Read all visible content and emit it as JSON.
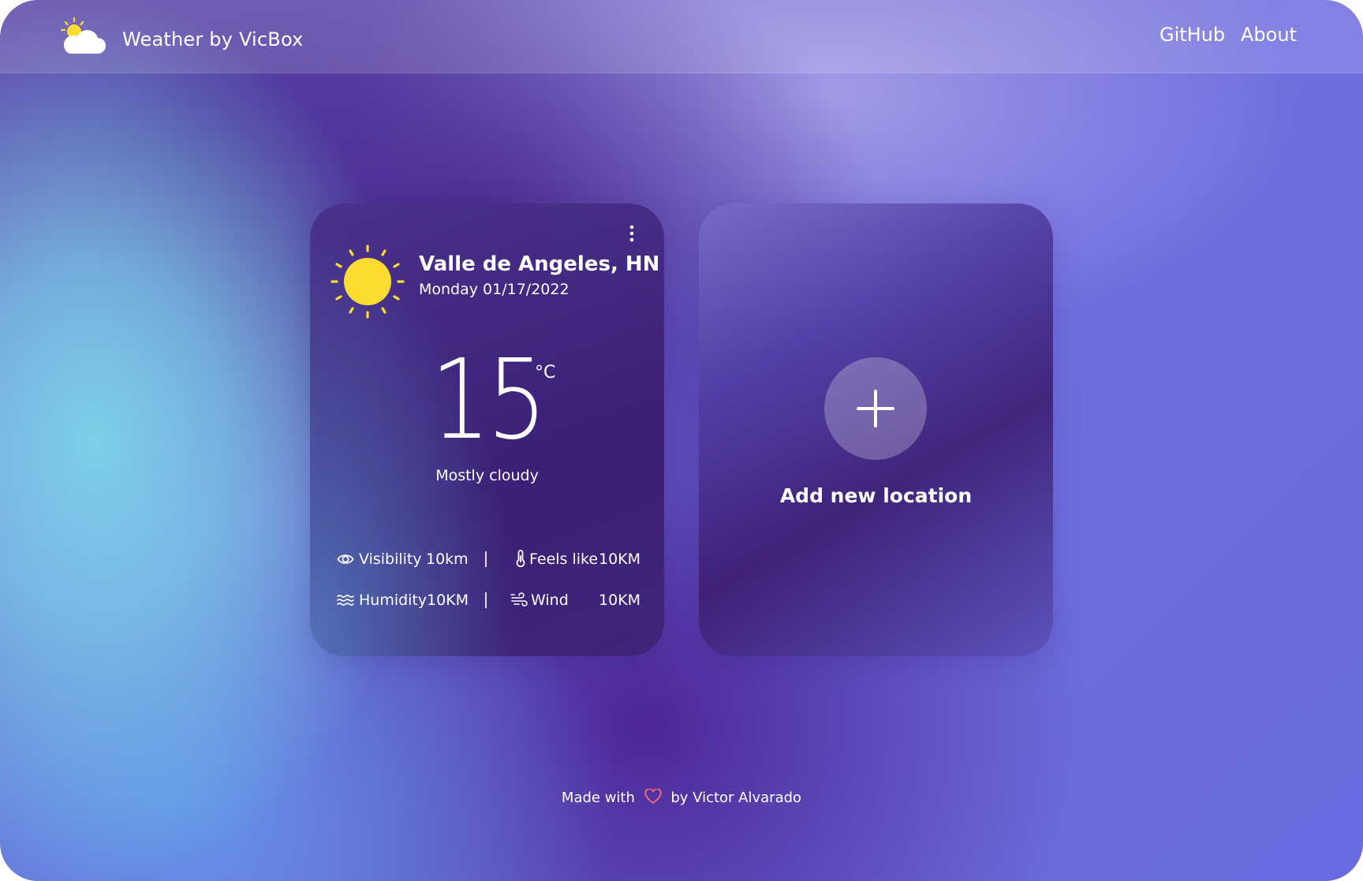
{
  "header": {
    "brand": "Weather by VicBox",
    "logo_icon": "sun-cloud-icon",
    "nav": [
      {
        "label": "GitHub"
      },
      {
        "label": "About"
      }
    ]
  },
  "weather_card": {
    "location": "Valle de Angeles, HN",
    "date": "Monday 01/17/2022",
    "temperature": "15",
    "unit": "°C",
    "condition": "Mostly cloudy",
    "icon": "sun-icon",
    "menu_icon": "more-vertical-icon",
    "stats": {
      "visibility": {
        "label": "Visibility",
        "value": "10km",
        "icon": "eye-icon"
      },
      "feels_like": {
        "label": "Feels like",
        "value": "10KM",
        "icon": "thermometer-icon"
      },
      "humidity": {
        "label": "Humidity",
        "value": "10KM",
        "icon": "waves-icon"
      },
      "wind": {
        "label": "Wind",
        "value": "10KM",
        "icon": "wind-icon"
      }
    }
  },
  "add_card": {
    "label": "Add new location",
    "icon": "plus-icon"
  },
  "footer": {
    "prefix": "Made with",
    "suffix": "by Victor Alvarado",
    "icon": "heart-icon"
  },
  "colors": {
    "sun": "#FDDC32",
    "heart": "#E86A7A",
    "text": "#FFFFFF"
  }
}
